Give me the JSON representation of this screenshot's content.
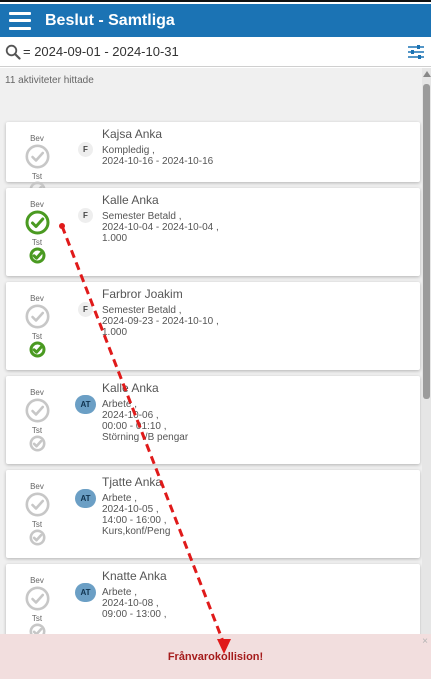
{
  "header": {
    "title": "Beslut - Samtliga"
  },
  "search": {
    "query": "= 2024-09-01 - 2024-10-31"
  },
  "list": {
    "count_text": "11 aktiviteter hittade",
    "label_bev": "Bev",
    "label_tst": "Tst",
    "items": [
      {
        "name": "Kajsa Anka",
        "type": "F",
        "lines": [
          "Kompledig ,",
          "2024-10-16 - 2024-10-16"
        ],
        "bev": "grey",
        "tst": "grey"
      },
      {
        "name": "Kalle Anka",
        "type": "F",
        "lines": [
          "Semester Betald ,",
          "2024-10-04 - 2024-10-04 ,",
          "1.000"
        ],
        "bev": "green",
        "tst": "green"
      },
      {
        "name": "Farbror Joakim",
        "type": "F",
        "lines": [
          "Semester Betald ,",
          "2024-09-23 - 2024-10-10 ,",
          "1.000"
        ],
        "bev": "grey",
        "tst": "green"
      },
      {
        "name": "Kalle Anka",
        "type": "AT",
        "lines": [
          "Arbete ,",
          "2024-10-06 ,",
          "00:00 - 01:10 ,",
          "Störning I/B pengar"
        ],
        "bev": "grey",
        "tst": "grey"
      },
      {
        "name": "Tjatte Anka",
        "type": "AT",
        "lines": [
          "Arbete ,",
          "2024-10-05 ,",
          "14:00 - 16:00 ,",
          "Kurs,konf/Peng"
        ],
        "bev": "grey",
        "tst": "grey"
      },
      {
        "name": "Knatte Anka",
        "type": "AT",
        "lines": [
          "Arbete ,",
          "2024-10-08 ,",
          "09:00 - 13:00 ,"
        ],
        "bev": "grey",
        "tst": "grey"
      }
    ]
  },
  "toast": {
    "message": "Frånvarokollision!",
    "close_label": "×"
  },
  "colors": {
    "header_bg": "#1b73b4",
    "green": "#4a9a21",
    "grey": "#c7c7c7",
    "toast_bg": "#f2dede",
    "toast_text": "#a51b1b",
    "arrow": "#e01a1a"
  }
}
